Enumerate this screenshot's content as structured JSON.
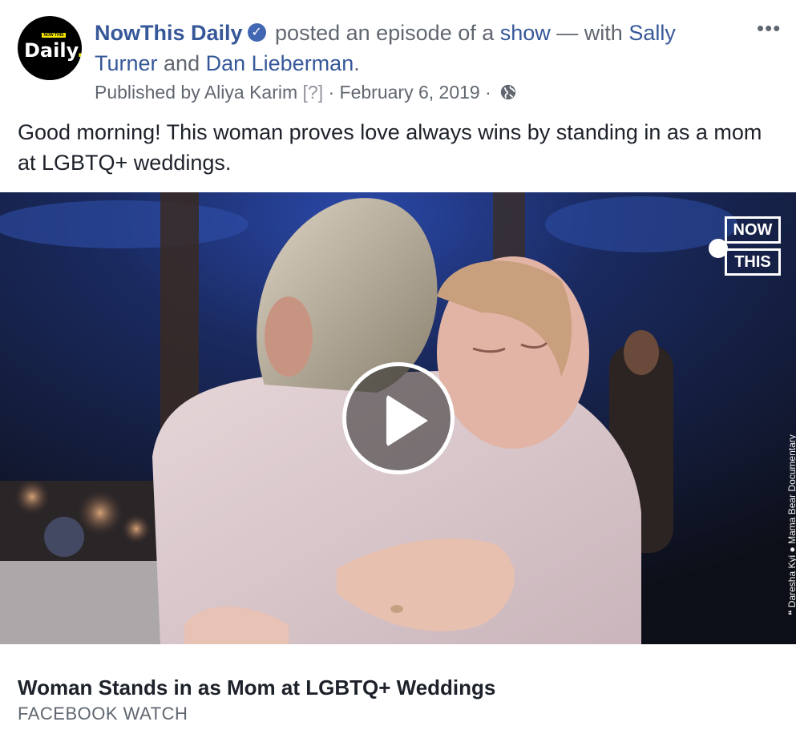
{
  "post": {
    "avatar_small_text": "NOW THIS",
    "avatar_text": "Daily",
    "avatar_dot": ".",
    "page_name": "NowThis Daily",
    "verified_mark": "✓",
    "action_text": " posted an episode of a ",
    "show_link": "show",
    "with_text": " — with ",
    "person1": "Sally Turner",
    "and_text": " and ",
    "person2": "Dan Lieberman",
    "period": ".",
    "published_by": "Published by Aliya Karim",
    "help_mark": " [?]",
    "date": " · February 6, 2019 ·",
    "privacy_icon": "globe-icon",
    "more_label": "•••",
    "caption": "Good morning! This woman proves love always wins by standing in as a mom at LGBTQ+ weddings."
  },
  "video": {
    "logo_now": "NOW",
    "logo_this": "THIS",
    "credit": "❝ Daresha Kyi  ● Mama Bear Documentary",
    "play_icon": "play-icon"
  },
  "link": {
    "title": "Woman Stands in as Mom at LGBTQ+ Weddings",
    "source": "FACEBOOK WATCH"
  },
  "colors": {
    "link_blue": "#365899",
    "meta_gray": "#616770",
    "verified_blue": "#4267b2",
    "brand_yellow": "#f7e600"
  }
}
